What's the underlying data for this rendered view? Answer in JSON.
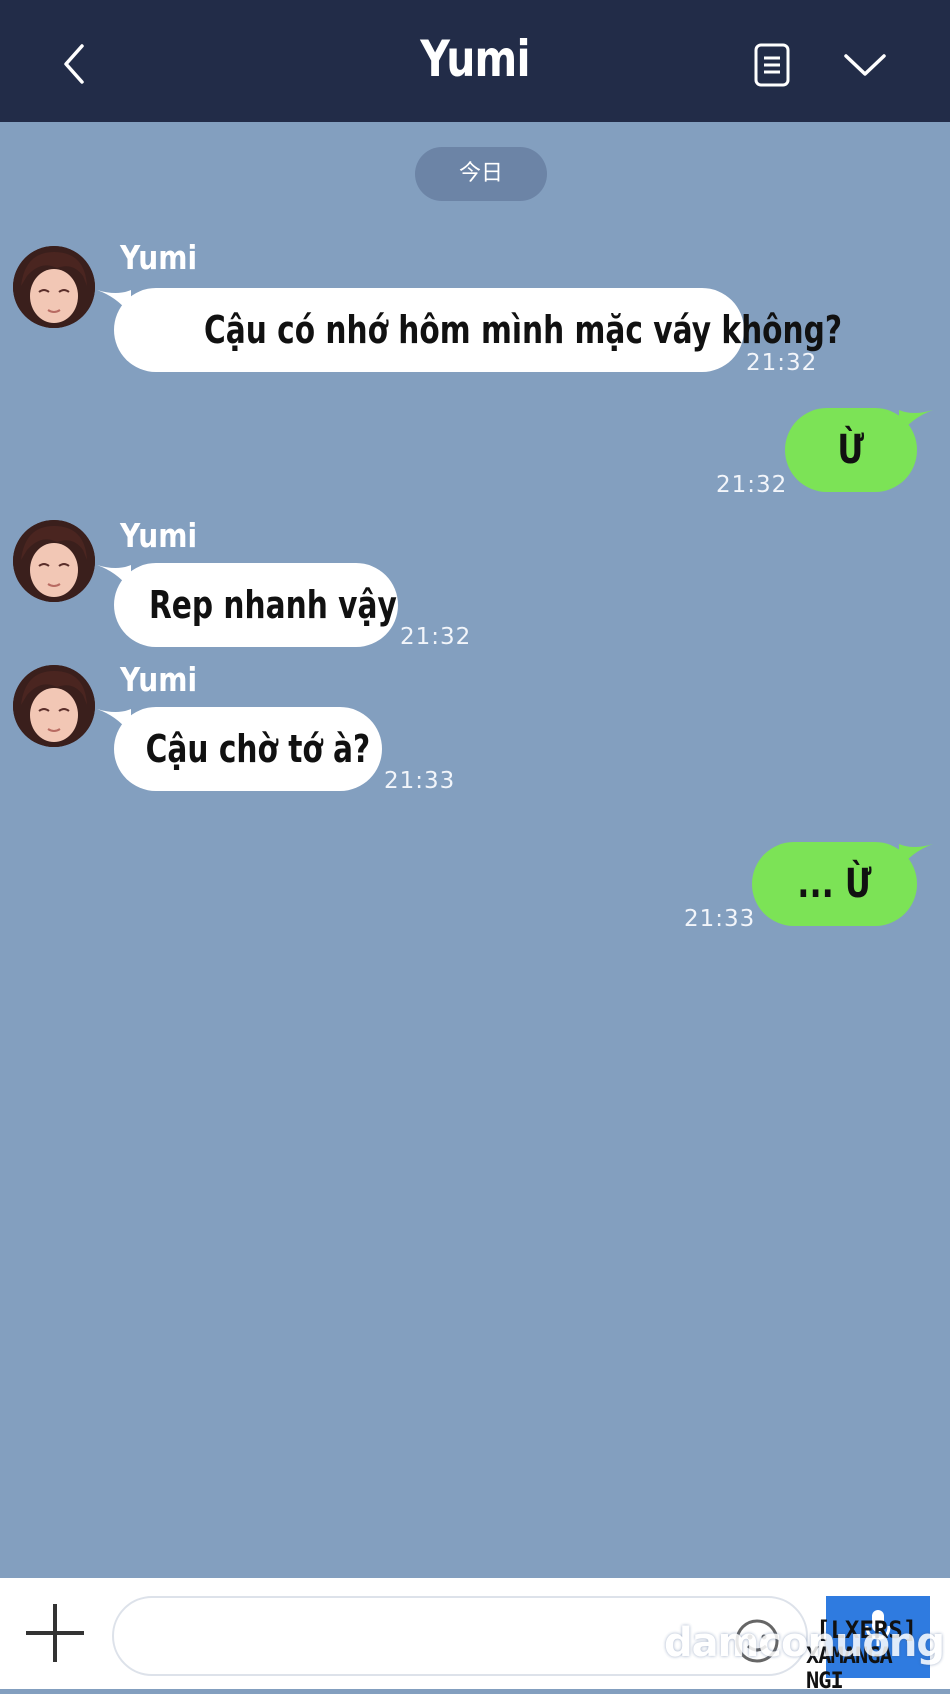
{
  "header": {
    "title": "Yumi",
    "back_icon": "chevron-left-icon",
    "notes_icon": "notes-icon",
    "menu_icon": "chevron-down-icon"
  },
  "date_separator": "今日",
  "messages": [
    {
      "direction": "in",
      "sender": "Yumi",
      "text": "Cậu có nhớ hôm mình mặc váy không?",
      "time": "21:32"
    },
    {
      "direction": "out",
      "text": "Ừ",
      "time": "21:32"
    },
    {
      "direction": "in",
      "sender": "Yumi",
      "text": "Rep nhanh vậy",
      "time": "21:32"
    },
    {
      "direction": "in",
      "sender": "Yumi",
      "text": "Cậu chờ tớ à?",
      "time": "21:33"
    },
    {
      "direction": "out",
      "text": "... Ừ",
      "time": "21:33"
    }
  ],
  "composer": {
    "input_value": "",
    "plus_icon": "plus-icon",
    "emoji_icon": "emoji-icon",
    "mic_icon": "microphone-icon"
  },
  "stamp": {
    "line1": "[LXERS]",
    "line2": "XAMANGA NGI"
  },
  "watermark": "damconuong",
  "colors": {
    "header_bg": "#222c48",
    "chat_bg": "#839fbf",
    "incoming_bubble": "#ffffff",
    "outgoing_bubble": "#7ce356",
    "send_button": "#2f7be0"
  }
}
